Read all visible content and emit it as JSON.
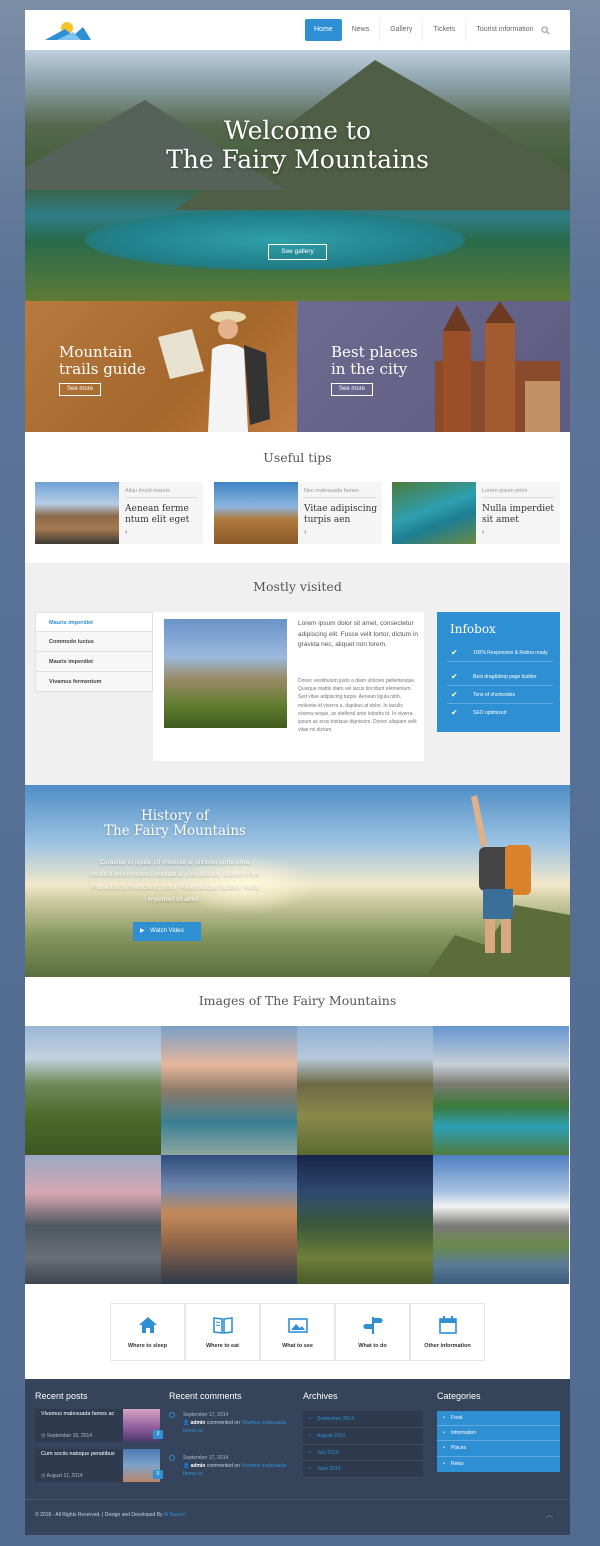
{
  "nav": {
    "items": [
      "Home",
      "News",
      "Gallery",
      "Tickets",
      "Tourist information"
    ],
    "active_index": 0
  },
  "hero": {
    "title_line1": "Welcome to",
    "title_line2": "The Fairy Mountains",
    "button": "See gallery"
  },
  "promos": [
    {
      "title_line1": "Mountain",
      "title_line2": "trails guide",
      "button": "See more"
    },
    {
      "title_line1": "Best places",
      "title_line2": "in the city",
      "button": "See more"
    }
  ],
  "tips": {
    "title": "Useful tips",
    "items": [
      {
        "category": "Aliqu tincid mauris",
        "title": "Aenean ferme ntum elit eget",
        "arrow": "›"
      },
      {
        "category": "Nec malesuada fames",
        "title": "Vitae adipiscing turpis aen",
        "arrow": "›"
      },
      {
        "category": "Lorem ipsum primi",
        "title": "Nulla imperdiet sit amet",
        "arrow": "›"
      }
    ]
  },
  "mostly_visited": {
    "title": "Mostly visited",
    "tabs": [
      "Mauris imperdiet",
      "Commodo luctus",
      "Mauris imperdiet",
      "Vivamus fermentum"
    ],
    "active_tab": 0,
    "lead": "Lorem ipsum dolor sit amet, consectetur adipiscing elit. Fusce velit tortor, dictum in gravida nec, aliquet non lorem.",
    "body": "Donec vestibulum justo a diam ultricies pellentesque. Quisque mattis diam vel lacus tincidunt elementum. Sed vitae adipiscing turpis. Aenean ligula nibh, molestie id viverra a, dapibus at dolor. In iaculis viverra neque, ac eleifend ante lobortis id. In viverra ipsum ac eros tristique dignissim. Donec aliquam velit vitae mi dictum."
  },
  "infobox": {
    "title": "Infobox",
    "items": [
      "100% Responsive & Retina ready",
      "Best drag&drop page builder",
      "Tons of shortcodes",
      "SEO optimized"
    ]
  },
  "history": {
    "title_line1": "History of",
    "title_line2": "The Fairy Mountains",
    "text": "Curabitur et ligula. Ut molestie a, ultricies porta urna. Vestibulum commodo volutpat a, convallis ac, laoreet enim. Phasellus fermentum in, dolor. Pellentesque facilisis. Nulla imperdiet sit amet .",
    "button": "Watch Video"
  },
  "gallery": {
    "title": "Images of The Fairy Mountains"
  },
  "services": [
    "Where to sleep",
    "Where to eat",
    "What to see",
    "What to do",
    "Other information"
  ],
  "footer": {
    "recent_posts_title": "Recent posts",
    "posts": [
      {
        "title": "Vivamus malesuada fames ac",
        "date": "September 16, 2014",
        "count": "3"
      },
      {
        "title": "Cum sociis natoque penatibus",
        "date": "August 11, 2014",
        "count": "0"
      }
    ],
    "recent_comments_title": "Recent comments",
    "comments": [
      {
        "date": "September 17, 2014",
        "author": "admin",
        "verb": "commented on",
        "link": "Vivamus malesuada fames ac"
      },
      {
        "date": "September 17, 2014",
        "author": "admin",
        "verb": "commented on",
        "link": "Vivamus malesuada fames ac"
      }
    ],
    "archives_title": "Archives",
    "archives": [
      "September 2014",
      "August 2014",
      "July 2014",
      "June 2014"
    ],
    "categories_title": "Categories",
    "categories": [
      "Food",
      "Information",
      "Places",
      "Relax"
    ],
    "copyright": "© 2018 - All Rights Reserved. | Design and Developed By",
    "author_link": "Al Nasem"
  },
  "colors": {
    "accent": "#2f8fd3",
    "footer_bg": "#35445a"
  }
}
